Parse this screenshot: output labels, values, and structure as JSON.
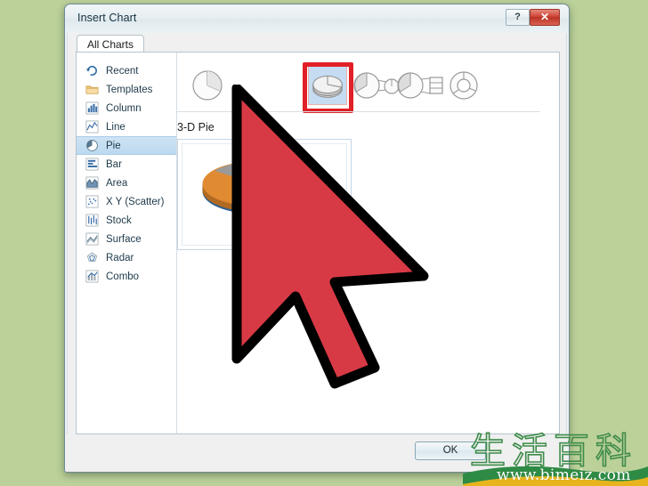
{
  "window": {
    "title": "Insert Chart",
    "help_button": "?",
    "close_button": "✕"
  },
  "tabs": [
    {
      "label": "All Charts",
      "selected": true
    }
  ],
  "sidebar": {
    "items": [
      {
        "label": "Recent",
        "icon": "recent-icon",
        "selected": false
      },
      {
        "label": "Templates",
        "icon": "folder-icon",
        "selected": false
      },
      {
        "label": "Column",
        "icon": "column-icon",
        "selected": false
      },
      {
        "label": "Line",
        "icon": "line-icon",
        "selected": false
      },
      {
        "label": "Pie",
        "icon": "pie-icon",
        "selected": true
      },
      {
        "label": "Bar",
        "icon": "bar-icon",
        "selected": false
      },
      {
        "label": "Area",
        "icon": "area-icon",
        "selected": false
      },
      {
        "label": "X Y (Scatter)",
        "icon": "scatter-icon",
        "selected": false
      },
      {
        "label": "Stock",
        "icon": "stock-icon",
        "selected": false
      },
      {
        "label": "Surface",
        "icon": "surface-icon",
        "selected": false
      },
      {
        "label": "Radar",
        "icon": "radar-icon",
        "selected": false
      },
      {
        "label": "Combo",
        "icon": "combo-icon",
        "selected": false
      }
    ]
  },
  "gallery": {
    "title": "3-D Pie",
    "thumbnails": [
      {
        "name": "pie",
        "selected": false
      },
      {
        "name": "3-d-pie",
        "selected": true
      },
      {
        "name": "pie-of-pie",
        "selected": false
      },
      {
        "name": "bar-of-pie",
        "selected": false
      },
      {
        "name": "doughnut",
        "selected": false
      }
    ],
    "highlight_color": "#e01f26"
  },
  "preview": {
    "chart_type": "3-D Pie",
    "slice_colors": [
      "#4a83bd",
      "#e08b32",
      "#9a9a9a",
      "#f2c230"
    ]
  },
  "footer": {
    "ok_label": "OK"
  },
  "cursor": {
    "fill_color": "#d83a45",
    "outline_color": "#000000"
  },
  "watermark": {
    "chinese_text": "生活百科",
    "url": "www.bimeiz.com"
  },
  "background": {
    "color": "#bcd19a"
  }
}
